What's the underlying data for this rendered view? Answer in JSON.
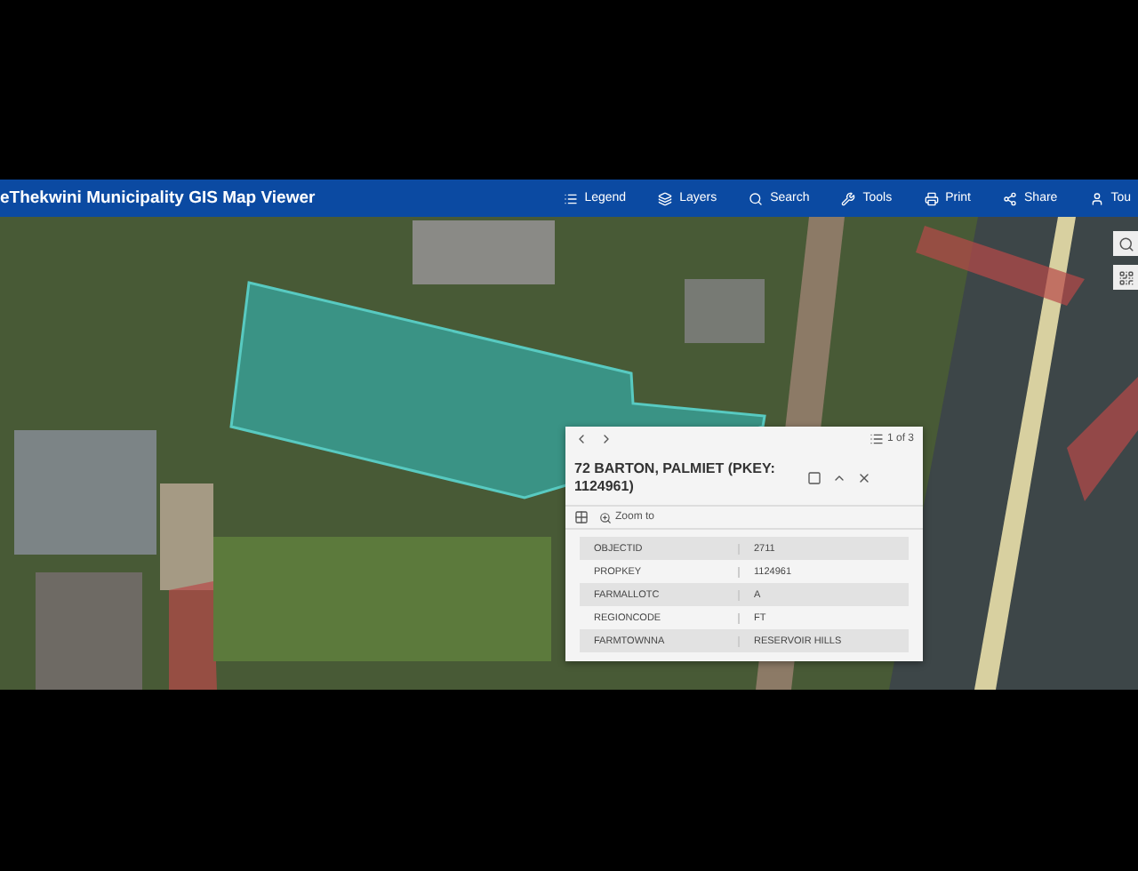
{
  "header": {
    "title": "eThekwini Municipality GIS Map Viewer",
    "nav": [
      {
        "kind": "legend",
        "label": "Legend"
      },
      {
        "kind": "layers",
        "label": "Layers"
      },
      {
        "kind": "search",
        "label": "Search"
      },
      {
        "kind": "tools",
        "label": "Tools"
      },
      {
        "kind": "print",
        "label": "Print"
      },
      {
        "kind": "share",
        "label": "Share"
      },
      {
        "kind": "tour",
        "label": "Tou"
      }
    ]
  },
  "popup": {
    "pager": "1 of 3",
    "title": "72 BARTON, PALMIET (PKEY: 1124961)",
    "zoom_label": "Zoom to",
    "rows": [
      {
        "field": "OBJECTID",
        "value": "2711"
      },
      {
        "field": "PROPKEY",
        "value": "1124961"
      },
      {
        "field": "FARMALLOTC",
        "value": "A"
      },
      {
        "field": "REGIONCODE",
        "value": "FT"
      },
      {
        "field": "FARMTOWNNA",
        "value": "RESERVOIR HILLS"
      }
    ]
  }
}
